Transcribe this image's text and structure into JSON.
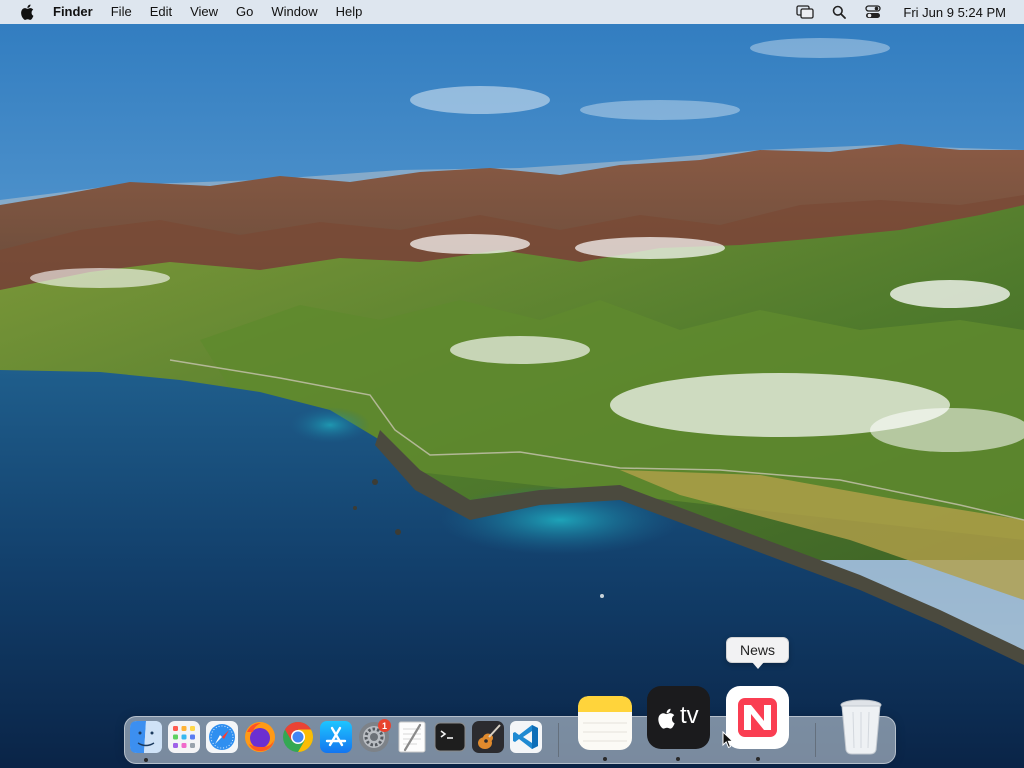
{
  "menubar": {
    "apple_icon": "apple-logo-icon",
    "app_name": "Finder",
    "menus": [
      "File",
      "Edit",
      "View",
      "Go",
      "Window",
      "Help"
    ],
    "status_icons": [
      "screen-mirroring-icon",
      "spotlight-search-icon",
      "control-center-icon"
    ],
    "clock": "Fri Jun 9  5:24 PM"
  },
  "tooltip": {
    "text": "News"
  },
  "dock": {
    "apps": [
      {
        "name": "Finder",
        "icon": "finder-icon",
        "running": true
      },
      {
        "name": "Launchpad",
        "icon": "launchpad-icon",
        "running": false
      },
      {
        "name": "Safari",
        "icon": "safari-icon",
        "running": false
      },
      {
        "name": "Firefox",
        "icon": "firefox-icon",
        "running": false
      },
      {
        "name": "Chrome",
        "icon": "chrome-icon",
        "running": false
      },
      {
        "name": "App Store",
        "icon": "app-store-icon",
        "running": false
      },
      {
        "name": "System Preferences",
        "icon": "system-preferences-icon",
        "running": false,
        "badge": "1"
      },
      {
        "name": "TextEdit",
        "icon": "textedit-icon",
        "running": false
      },
      {
        "name": "Terminal",
        "icon": "terminal-icon",
        "running": false
      },
      {
        "name": "GarageBand",
        "icon": "garageband-icon",
        "running": false
      },
      {
        "name": "Visual Studio Code",
        "icon": "vscode-icon",
        "running": false
      },
      {
        "name": "Notes",
        "icon": "notes-icon",
        "running": true
      },
      {
        "name": "TV",
        "icon": "apple-tv-icon",
        "running": true,
        "label": "tv"
      },
      {
        "name": "News",
        "icon": "news-icon",
        "running": true
      },
      {
        "name": "Trash",
        "icon": "trash-icon",
        "running": false
      }
    ]
  },
  "colors": {
    "menubar_bg": "#eceef2",
    "news_red": "#fa3e52",
    "badge_red": "#e8432f"
  }
}
